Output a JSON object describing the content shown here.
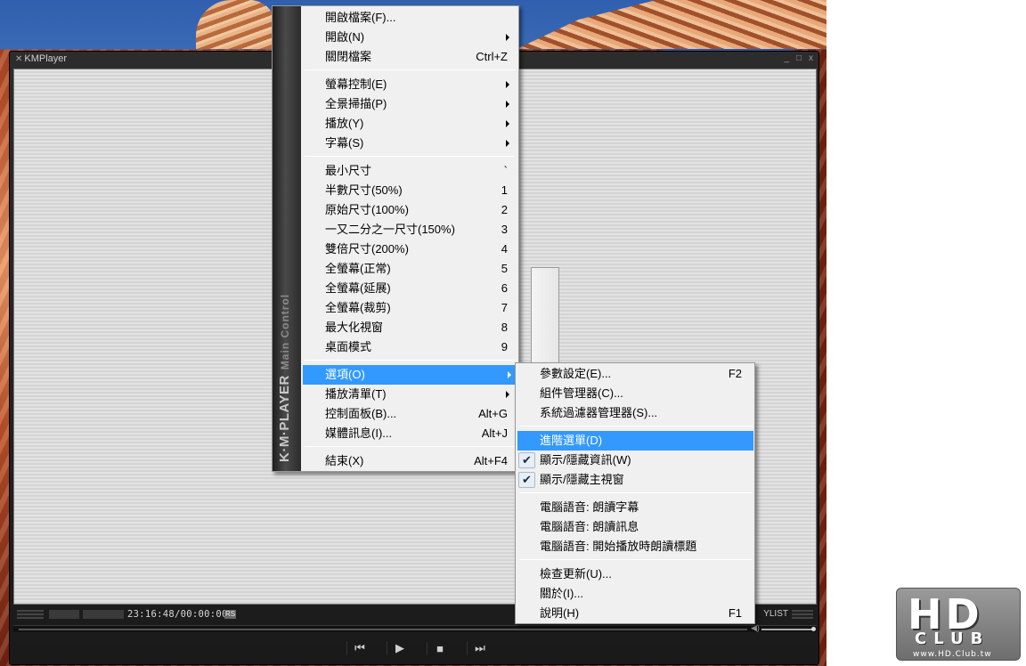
{
  "window": {
    "title": "KMPlayer",
    "controls": [
      "_",
      "□",
      "x"
    ]
  },
  "status_bar": {
    "time": "23:16:48/00:00:00",
    "rs": "RS",
    "playlist_label": "YLIST"
  },
  "transport": {
    "prev": "⏮",
    "play": "▶",
    "stop": "■",
    "next": "⏭"
  },
  "main_menu": {
    "brand": "K·M·PLAYER",
    "brand_sub": "Main Control",
    "items": [
      {
        "label": "開啟檔案(F)...",
        "shortcut": "",
        "submenu": false
      },
      {
        "label": "開啟(N)",
        "shortcut": "",
        "submenu": true
      },
      {
        "label": "關閉檔案",
        "shortcut": "Ctrl+Z",
        "submenu": false
      },
      {
        "label": "螢幕控制(E)",
        "shortcut": "",
        "submenu": true
      },
      {
        "label": "全景掃描(P)",
        "shortcut": "",
        "submenu": true
      },
      {
        "label": "播放(Y)",
        "shortcut": "",
        "submenu": true
      },
      {
        "label": "字幕(S)",
        "shortcut": "",
        "submenu": true
      },
      {
        "label": "最小尺寸",
        "shortcut": "`",
        "submenu": false
      },
      {
        "label": "半數尺寸(50%)",
        "shortcut": "1",
        "submenu": false
      },
      {
        "label": "原始尺寸(100%)",
        "shortcut": "2",
        "submenu": false
      },
      {
        "label": "一又二分之一尺寸(150%)",
        "shortcut": "3",
        "submenu": false
      },
      {
        "label": "雙倍尺寸(200%)",
        "shortcut": "4",
        "submenu": false
      },
      {
        "label": "全螢幕(正常)",
        "shortcut": "5",
        "submenu": false
      },
      {
        "label": "全螢幕(延展)",
        "shortcut": "6",
        "submenu": false
      },
      {
        "label": "全螢幕(裁剪)",
        "shortcut": "7",
        "submenu": false
      },
      {
        "label": "最大化視窗",
        "shortcut": "8",
        "submenu": false
      },
      {
        "label": "桌面模式",
        "shortcut": "9",
        "submenu": false
      },
      {
        "label": "選項(O)",
        "shortcut": "",
        "submenu": true,
        "highlighted": true
      },
      {
        "label": "播放清單(T)",
        "shortcut": "",
        "submenu": true
      },
      {
        "label": "控制面板(B)...",
        "shortcut": "Alt+G",
        "submenu": false
      },
      {
        "label": "媒體訊息(I)...",
        "shortcut": "Alt+J",
        "submenu": false
      },
      {
        "label": "結束(X)",
        "shortcut": "Alt+F4",
        "submenu": false
      }
    ]
  },
  "options_submenu": {
    "items": [
      {
        "label": "參數設定(E)...",
        "shortcut": "F2"
      },
      {
        "label": "組件管理器(C)...",
        "shortcut": ""
      },
      {
        "label": "系統過濾器管理器(S)...",
        "shortcut": ""
      },
      {
        "label": "進階選單(D)",
        "shortcut": "",
        "highlighted": true
      },
      {
        "label": "顯示/隱藏資訊(W)",
        "shortcut": "",
        "checked": true
      },
      {
        "label": "顯示/隱藏主視窗",
        "shortcut": "",
        "checked": true
      },
      {
        "label": "電腦語音: 朗讀字幕",
        "shortcut": ""
      },
      {
        "label": "電腦語音: 朗讀訊息",
        "shortcut": ""
      },
      {
        "label": "電腦語音: 開始播放時朗讀標題",
        "shortcut": ""
      },
      {
        "label": "檢查更新(U)...",
        "shortcut": ""
      },
      {
        "label": "關於(I)...",
        "shortcut": ""
      },
      {
        "label": "說明(H)",
        "shortcut": "F1"
      }
    ],
    "check_glyph": "✔"
  },
  "watermark": {
    "big": "HD",
    "club": "CLUB",
    "url": "www.HD.Club.tw"
  }
}
